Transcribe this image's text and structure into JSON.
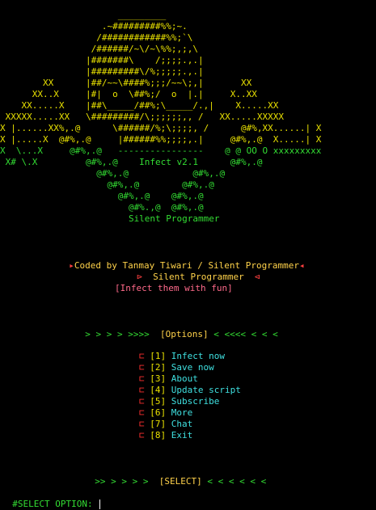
{
  "banner": {
    "ascii_lines": [
      "                      _________",
      "                   .~#########%%;~.",
      "                  /############%%;`\\",
      "                 /######/~\\/~\\%%;,;,\\",
      "                |#######\\    /;;;;.,.|",
      "                |#########\\/%;;;;;.,.|",
      "        XX      |##/~~\\####%;;;/~~\\;,|       XX",
      "      XX..X     |#|  o  \\##%;/  o  |.|     X..XX",
      "    XX.....X    |##\\_____/##%;\\_____/.,|    X.....XX",
      " XXXXX.....XX   \\#########/\\;;;;;;,, /   XX.....XXXXX",
      "X |......XX%,.@      \\######/%;\\;;;;, /      @#%,XX......| X",
      "X |.....X  @#%,.@     |######%%;;;;,.|     @#%,.@  X.....| X",
      "X  \\...X     @#%,.@   ----------------    @ @ OO O xxxxxxxxx",
      " X# \\.X         @#%,.@    Infect v2.1      @#%,.@",
      "                  @#%,.@            @#%,.@",
      "                    @#%,.@        @#%,.@",
      "                      @#%,.@    @#%,.@",
      "                        @#%.,@  @#%,.@",
      "                        Silent Programmer"
    ],
    "coded_by": "Coded by Tanmay Tiwari / Silent Programmer",
    "author": "Silent Programmer",
    "tagline": "[Infect them with fun]"
  },
  "options_header": {
    "left_arrows": "> > > > >>>>",
    "label": "[Options]",
    "right_arrows": "< <<<< < < <"
  },
  "menu": [
    {
      "num": "[1]",
      "label": "Infect now"
    },
    {
      "num": "[2]",
      "label": "Save now"
    },
    {
      "num": "[3]",
      "label": "About"
    },
    {
      "num": "[4]",
      "label": "Update script"
    },
    {
      "num": "[5]",
      "label": "Subscribe"
    },
    {
      "num": "[6]",
      "label": "More"
    },
    {
      "num": "[7]",
      "label": "Chat"
    },
    {
      "num": "[8]",
      "label": "Exit"
    }
  ],
  "select_header": {
    "left_arrows": ">> > > > >",
    "label": "[SELECT]",
    "right_arrows": "< < < < < <"
  },
  "prompt": {
    "label": "#SELECT OPTION:",
    "value": ""
  },
  "colors": {
    "background": "#000000",
    "ascii_yellow": "#e8e000",
    "ascii_green": "#33dd33",
    "accent_red": "#ff4040",
    "menu_cyan": "#3fe0e0"
  }
}
